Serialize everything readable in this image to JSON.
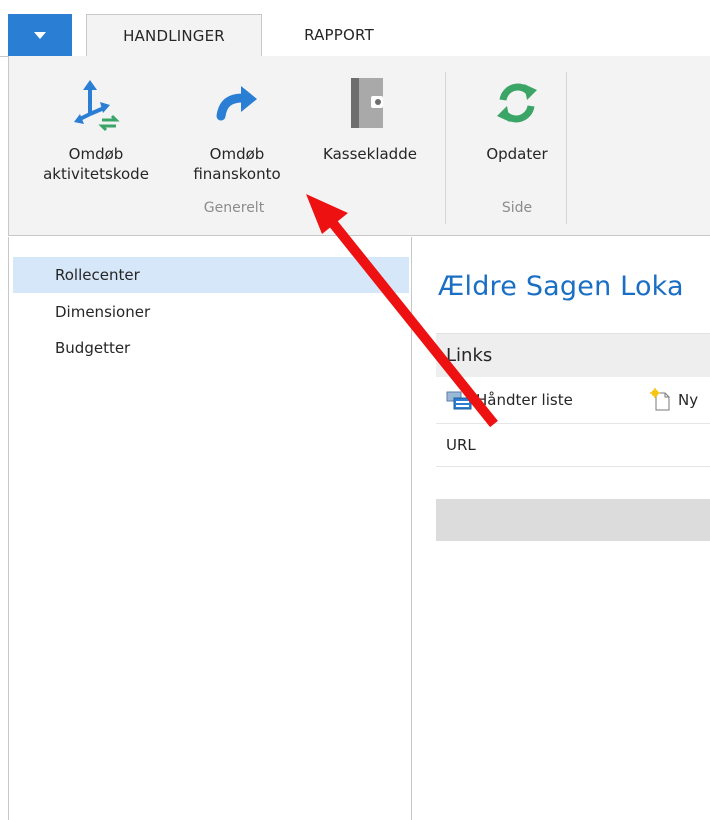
{
  "tabs": [
    {
      "label": "HANDLINGER",
      "active": true
    },
    {
      "label": "RAPPORT",
      "active": false
    }
  ],
  "ribbon": {
    "groups": [
      {
        "label": "Generelt",
        "buttons": [
          {
            "label_line1": "Omdøb",
            "label_line2": "aktivitetskode",
            "icon": "rename-dimension-icon"
          },
          {
            "label_line1": "Omdøb",
            "label_line2": "finanskonto",
            "icon": "arrow-right-icon"
          },
          {
            "label_line1": "Kassekladde",
            "label_line2": "",
            "icon": "journal-book-icon"
          }
        ]
      },
      {
        "label": "Side",
        "buttons": [
          {
            "label_line1": "Opdater",
            "label_line2": "",
            "icon": "refresh-icon"
          }
        ]
      }
    ]
  },
  "nav": {
    "items": [
      {
        "label": "Rollecenter",
        "selected": true
      },
      {
        "label": "Dimensioner",
        "selected": false
      },
      {
        "label": "Budgetter",
        "selected": false
      }
    ]
  },
  "content": {
    "title": "Ældre Sagen Loka",
    "links": {
      "title": "Links",
      "toolbar": [
        {
          "label": "Håndter liste",
          "icon": "manage-list-icon"
        },
        {
          "label": "Ny",
          "icon": "new-document-icon"
        }
      ],
      "columns": [
        "URL"
      ]
    }
  },
  "colors": {
    "accent": "#2a7ed3",
    "title_blue": "#1a6fc4",
    "selected_nav": "#d5e7f8",
    "annotation_red": "#ee1111"
  }
}
